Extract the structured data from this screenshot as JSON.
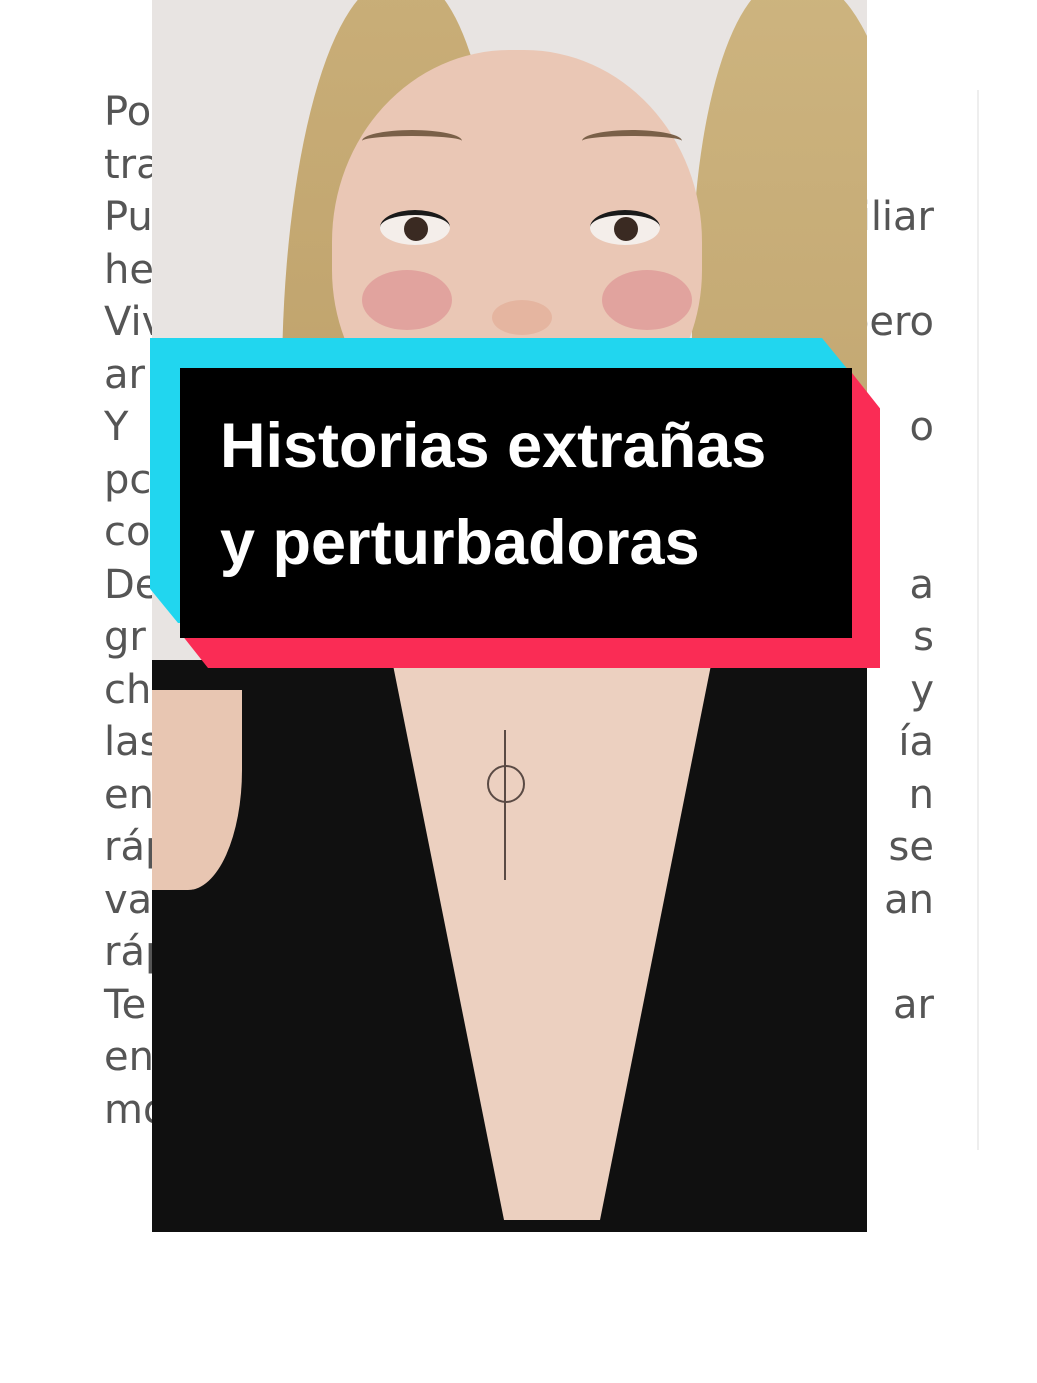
{
  "document": {
    "lines": [
      {
        "left": "Por gene",
        "right": ""
      },
      {
        "left": "transcen",
        "right": ""
      },
      {
        "left": "Pues res",
        "right": "miliar"
      },
      {
        "left": "herman",
        "right": ""
      },
      {
        "left": "Vivimos",
        "right": "pero"
      },
      {
        "left": "ar",
        "right": ""
      },
      {
        "left": "Y",
        "right": "o"
      },
      {
        "left": "pc",
        "right": ""
      },
      {
        "left": "co",
        "right": ""
      },
      {
        "left": "De",
        "right": "a"
      },
      {
        "left": "gr",
        "right": "s"
      },
      {
        "left": "ch",
        "right": "y"
      },
      {
        "left": "las",
        "right": "ía"
      },
      {
        "left": "en",
        "right": "n"
      },
      {
        "left": "ráp",
        "right": "se"
      },
      {
        "left": "va",
        "right": "an"
      },
      {
        "left": "ráp",
        "right": ""
      },
      {
        "left": "Te",
        "right": "ar"
      },
      {
        "left": "en",
        "right": ""
      },
      {
        "left": "mo",
        "right": ""
      }
    ]
  },
  "banner": {
    "title_line1": "Historias extrañas",
    "title_line2": "y perturbadoras",
    "colors": {
      "cyan": "#21d6ef",
      "red": "#fa2c55",
      "fill": "#000000",
      "text": "#ffffff"
    }
  },
  "photo": {
    "subject": "woman-portrait"
  }
}
